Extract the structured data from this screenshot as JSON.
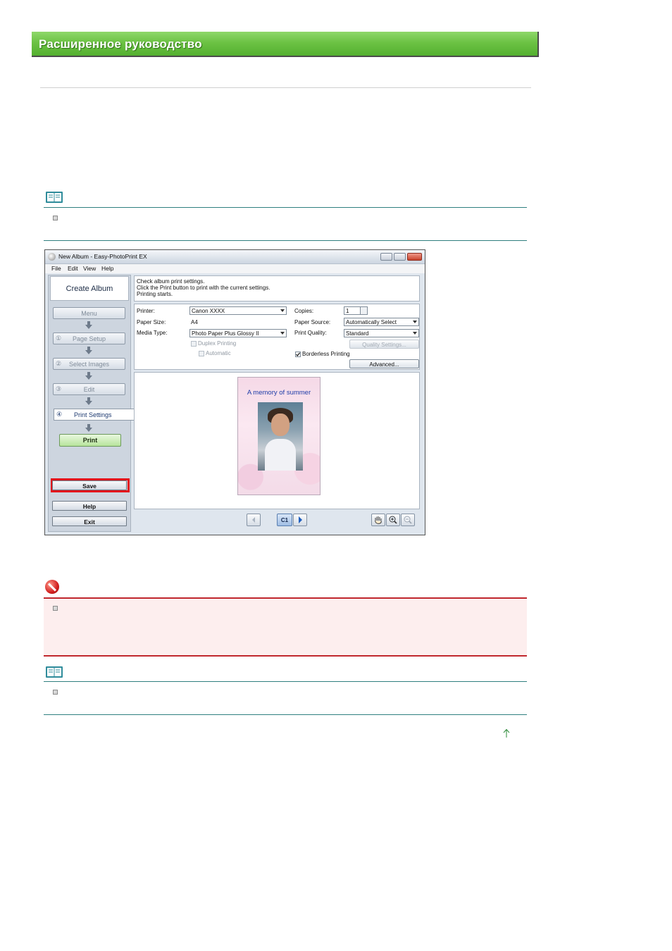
{
  "header": {
    "title": "Расширенное руководство"
  },
  "window": {
    "title": "New Album - Easy-PhotoPrint EX",
    "menu": [
      "File",
      "Edit",
      "View",
      "Help"
    ],
    "sidebar": {
      "heading": "Create Album",
      "menu_label": "Menu",
      "steps": [
        {
          "num": "①",
          "label": "Page Setup"
        },
        {
          "num": "②",
          "label": "Select Images"
        },
        {
          "num": "③",
          "label": "Edit"
        },
        {
          "num": "④",
          "label": "Print Settings"
        }
      ],
      "print_label": "Print",
      "save_label": "Save",
      "help_label": "Help",
      "exit_label": "Exit"
    },
    "instructions": [
      "Check album print settings.",
      "Click the Print button to print with the current settings.",
      "Printing starts."
    ],
    "settings": {
      "printer_label": "Printer:",
      "printer_value": "Canon XXXX",
      "paper_size_label": "Paper Size:",
      "paper_size_value": "A4",
      "media_type_label": "Media Type:",
      "media_type_value": "Photo Paper Plus Glossy II",
      "duplex_label": "Duplex Printing",
      "automatic_label": "Automatic",
      "copies_label": "Copies:",
      "copies_value": "1",
      "paper_source_label": "Paper Source:",
      "paper_source_value": "Automatically Select",
      "print_quality_label": "Print Quality:",
      "print_quality_value": "Standard",
      "quality_settings_label": "Quality Settings...",
      "borderless_label": "Borderless Printing",
      "advanced_label": "Advanced..."
    },
    "preview": {
      "page_title": "A memory of summer",
      "page_indicator": "C1"
    }
  },
  "colors": {
    "header_green": "#6cc244",
    "important_red": "#c0272d",
    "note_teal": "#2f7f7f",
    "save_highlight": "#e2141c"
  },
  "icons": [
    "note-icon",
    "important-icon",
    "top-arrow-icon",
    "hand-icon",
    "zoom-in-icon",
    "zoom-out-icon"
  ]
}
